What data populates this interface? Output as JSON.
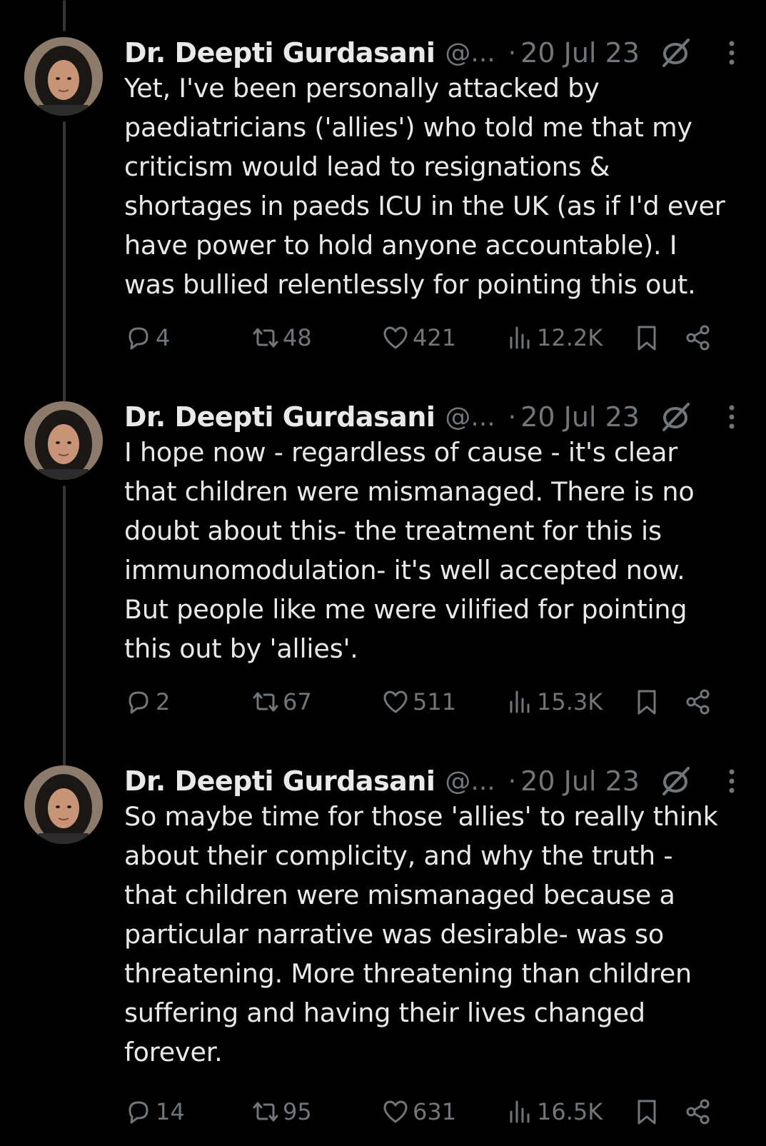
{
  "tweets": [
    {
      "author": "Dr. Deepti Gurdasani",
      "handle": "@...",
      "separator": "·",
      "date": "20 Jul 23",
      "lines": [
        "Yet, I've been personally attacked by",
        "paediatricians ('allies') who told me that my",
        "criticism would lead to resignations &",
        "shortages in paeds ICU in the UK (as if I'd ever",
        "have power to hold anyone accountable). I",
        "was bullied relentlessly for pointing this out."
      ],
      "replies": "4",
      "reposts": "48",
      "likes": "421",
      "views": "12.2K"
    },
    {
      "author": "Dr. Deepti Gurdasani",
      "handle": "@...",
      "separator": "·",
      "date": "20 Jul 23",
      "lines": [
        "I hope now - regardless of cause - it's clear",
        "that children were mismanaged. There is no",
        "doubt about this- the treatment for this is",
        "immunomodulation- it's well accepted now.",
        "But people like me were vilified for pointing",
        "this out by 'allies'."
      ],
      "replies": "2",
      "reposts": "67",
      "likes": "511",
      "views": "15.3K"
    },
    {
      "author": "Dr. Deepti Gurdasani",
      "handle": "@...",
      "separator": "·",
      "date": "20 Jul 23",
      "lines": [
        "So maybe time for those 'allies' to really think",
        "about their complicity, and why the truth -",
        "that children were mismanaged because a",
        "particular narrative was desirable- was so",
        "threatening. More threatening than children",
        "suffering and having their lives changed",
        "forever."
      ],
      "replies": "14",
      "reposts": "95",
      "likes": "631",
      "views": "16.5K"
    }
  ],
  "icons": {
    "avatar": "profile-photo",
    "muted": "muted-icon",
    "more": "more-icon",
    "reply": "reply-icon",
    "repost": "repost-icon",
    "like": "like-icon",
    "views": "views-icon",
    "bookmark": "bookmark-icon",
    "share": "share-icon"
  },
  "colors": {
    "background": "#000000",
    "text": "#e7e9ea",
    "secondary": "#71767b",
    "thread_line": "#333639"
  }
}
